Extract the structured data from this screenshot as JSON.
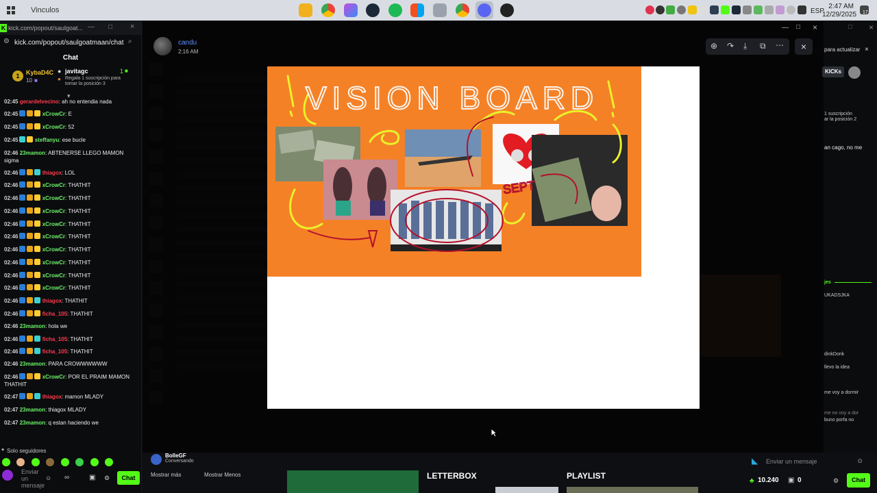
{
  "taskbar": {
    "window_title": "Vinculos",
    "time": "2:47 AM",
    "date": "12/29/2025",
    "lang": "ESP",
    "notif_count": "17"
  },
  "kick": {
    "tab_title": "kick.com/popout/saulgoat...",
    "url": "kick.com/popout/saulgoatmaan/chat",
    "chat_header": "Chat",
    "gifter_rank": "1",
    "gifter_name": "KybaD4C",
    "gifter_count": "10",
    "gift_target": "javitagc",
    "gift_target_count": "1",
    "gift_text": "Regala 1 suscripción para tomar la posición 3",
    "messages": [
      {
        "time": "02:45",
        "user": "gerardelvecino",
        "color": "red",
        "text": ": ah no entendia nada",
        "badges": []
      },
      {
        "time": "02:45",
        "user": "xCrowCr",
        "color": "green",
        "text": ": E",
        "badges": [
          "#2a7dd6",
          "#e6a31a",
          "#ffcc33"
        ]
      },
      {
        "time": "02:45",
        "user": "xCrowCr",
        "color": "green",
        "text": ": 52",
        "badges": [
          "#2a7dd6",
          "#e6a31a",
          "#ffcc33"
        ]
      },
      {
        "time": "02:45",
        "user": "steffanyu",
        "color": "green",
        "text": ": ese bucle",
        "badges": [
          "#3ad0d0",
          "#ffcc33"
        ]
      },
      {
        "time": "02:46",
        "user": "23mamon",
        "color": "green",
        "text": ": ABTENERSE LLEGO MAMON sigma",
        "badges": []
      },
      {
        "time": "02:46",
        "user": "thiagox",
        "color": "red",
        "text": ": LOL",
        "badges": [
          "#2a7dd6",
          "#e6a31a",
          "#3ad0d0"
        ]
      },
      {
        "time": "02:46",
        "user": "xCrowCr",
        "color": "green",
        "text": ": THATHIT",
        "badges": [
          "#2a7dd6",
          "#e6a31a",
          "#ffcc33"
        ]
      },
      {
        "time": "02:46",
        "user": "xCrowCr",
        "color": "green",
        "text": ": THATHIT",
        "badges": [
          "#2a7dd6",
          "#e6a31a",
          "#ffcc33"
        ]
      },
      {
        "time": "02:46",
        "user": "xCrowCr",
        "color": "green",
        "text": ": THATHIT",
        "badges": [
          "#2a7dd6",
          "#e6a31a",
          "#ffcc33"
        ]
      },
      {
        "time": "02:46",
        "user": "xCrowCr",
        "color": "green",
        "text": ": THATHIT",
        "badges": [
          "#2a7dd6",
          "#e6a31a",
          "#ffcc33"
        ]
      },
      {
        "time": "02:46",
        "user": "xCrowCr",
        "color": "green",
        "text": ": THATHIT",
        "badges": [
          "#2a7dd6",
          "#e6a31a",
          "#ffcc33"
        ]
      },
      {
        "time": "02:46",
        "user": "xCrowCr",
        "color": "green",
        "text": ": THATHIT",
        "badges": [
          "#2a7dd6",
          "#e6a31a",
          "#ffcc33"
        ]
      },
      {
        "time": "02:46",
        "user": "xCrowCr",
        "color": "green",
        "text": ": THATHIT",
        "badges": [
          "#2a7dd6",
          "#e6a31a",
          "#ffcc33"
        ]
      },
      {
        "time": "02:46",
        "user": "xCrowCr",
        "color": "green",
        "text": ": THATHIT",
        "badges": [
          "#2a7dd6",
          "#e6a31a",
          "#ffcc33"
        ]
      },
      {
        "time": "02:46",
        "user": "xCrowCr",
        "color": "green",
        "text": ": THATHIT",
        "badges": [
          "#2a7dd6",
          "#e6a31a",
          "#ffcc33"
        ]
      },
      {
        "time": "02:46",
        "user": "thiagox",
        "color": "red",
        "text": ": THATHIT",
        "badges": [
          "#2a7dd6",
          "#e6a31a",
          "#3ad0d0"
        ]
      },
      {
        "time": "02:46",
        "user": "ficha_105",
        "color": "red",
        "text": ": THATHIT",
        "badges": [
          "#2a7dd6",
          "#e6a31a",
          "#ffcc33"
        ]
      },
      {
        "time": "02:46",
        "user": "23mamon",
        "color": "green",
        "text": ": hola we",
        "badges": []
      },
      {
        "time": "02:46",
        "user": "ficha_105",
        "color": "red",
        "text": ": THATHIT",
        "badges": [
          "#2a7dd6",
          "#e6a31a",
          "#3ad0d0"
        ]
      },
      {
        "time": "02:46",
        "user": "ficha_105",
        "color": "red",
        "text": ": THATHIT",
        "badges": [
          "#2a7dd6",
          "#e6a31a",
          "#3ad0d0"
        ]
      },
      {
        "time": "02:46",
        "user": "23mamon",
        "color": "green",
        "text": ": PARA CROWWWWWW",
        "badges": []
      },
      {
        "time": "02:46",
        "user": "xCrowCr",
        "color": "green",
        "text": ": POR EL PRAIM MAMON THATHIT",
        "badges": [
          "#2a7dd6",
          "#e6a31a",
          "#ffcc33"
        ]
      },
      {
        "time": "02:47",
        "user": "thiagox",
        "color": "red",
        "text": ": mamon MLADY",
        "badges": [
          "#2a7dd6",
          "#e6a31a",
          "#3ad0d0"
        ]
      },
      {
        "time": "02:47",
        "user": "23mamon",
        "color": "green",
        "text": ": thiagox MLADY",
        "badges": []
      },
      {
        "time": "02:47",
        "user": "23mamon",
        "color": "green",
        "text": ": q estan haciendo we",
        "badges": []
      }
    ],
    "followers_only": "Solo seguidores",
    "send_placeholder": "Enviar un mensaje",
    "chat_button": "Chat"
  },
  "viewer": {
    "author": "candu",
    "time": "2:16 AM"
  },
  "vision_board": {
    "title": "VISION BOARD",
    "scribble": "SEPT"
  },
  "right_panel": {
    "lines": [
      "para actualizar",
      "KICKs",
      "1 suscripción",
      "ar la posición 2",
      "an cago, no me",
      "jes",
      "UKADSJKA",
      "dinkDonk",
      "llevo la idea",
      "me voy a dormir",
      "me no voy a dor",
      "buno porfa no"
    ]
  },
  "bottom": {
    "stream_user": "BolleGF",
    "stream_status": "Conversando",
    "mostrar_mas": "Mostrar más",
    "mostrar_menos": "Mostrar Menos",
    "letterbox": "LETTERBOX",
    "playlist": "PLAYLIST",
    "send_placeholder": "Enviar un mensaje",
    "points": "10.240",
    "gifts": "0",
    "chat_button": "Chat"
  }
}
